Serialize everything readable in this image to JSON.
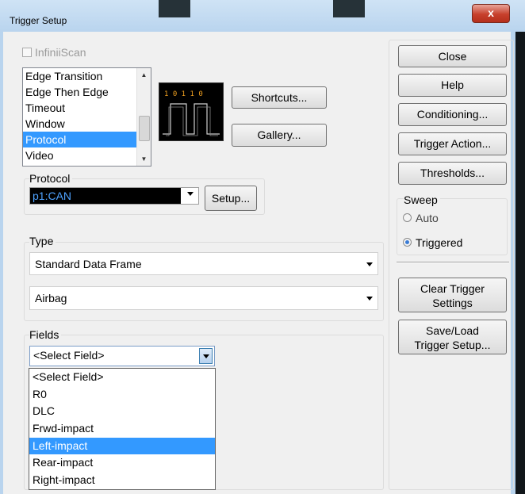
{
  "window": {
    "title": "Trigger Setup",
    "close_glyph": "x"
  },
  "infiniiscan": {
    "label": "InfiniiScan",
    "checked": false
  },
  "trigger_types": {
    "items": [
      "Edge Transition",
      "Edge Then Edge",
      "Timeout",
      "Window",
      "Protocol",
      "Video"
    ],
    "selected": "Protocol"
  },
  "preview": {
    "bits": "1 0 1 1 0"
  },
  "buttons": {
    "shortcuts": "Shortcuts...",
    "gallery": "Gallery..."
  },
  "protocol": {
    "group_label": "Protocol",
    "value": "p1:CAN",
    "setup": "Setup..."
  },
  "type": {
    "group_label": "Type",
    "frame_value": "Standard Data Frame",
    "message_value": "Airbag"
  },
  "fields": {
    "group_label": "Fields",
    "value": "<Select Field>",
    "options": [
      "<Select Field>",
      "R0",
      "DLC",
      "Frwd-impact",
      "Left-impact",
      "Rear-impact",
      "Right-impact"
    ],
    "highlighted": "Left-impact"
  },
  "side": {
    "close": "Close",
    "help": "Help",
    "conditioning": "Conditioning...",
    "trigger_action": "Trigger Action...",
    "thresholds": "Thresholds...",
    "sweep_label": "Sweep",
    "auto": "Auto",
    "triggered": "Triggered",
    "sweep_selected": "Triggered",
    "clear_trigger_l1": "Clear Trigger",
    "clear_trigger_l2": "Settings",
    "saveload_l1": "Save/Load",
    "saveload_l2": "Trigger Setup..."
  },
  "colors": {
    "selection": "#3399ff",
    "protocol_text": "#4fa3ff"
  }
}
